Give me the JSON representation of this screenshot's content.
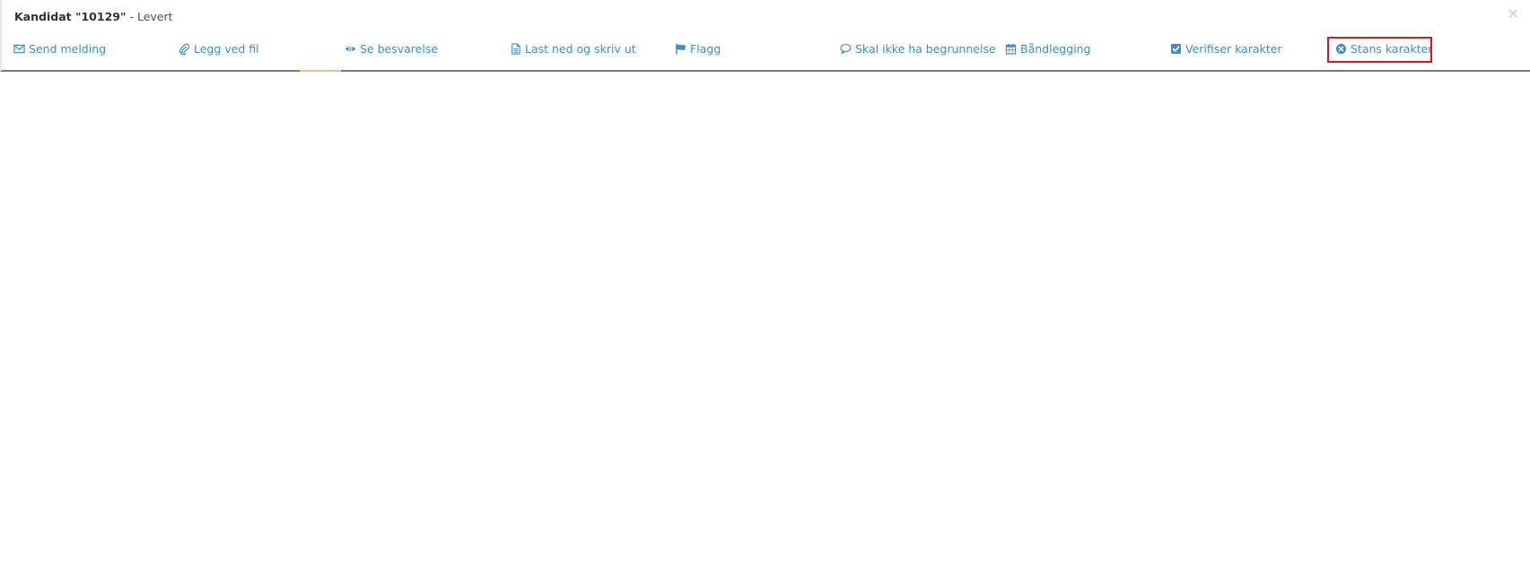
{
  "panel": {
    "title_name": "Kandidat \"10129\"",
    "title_separator": " - ",
    "title_status": "Levert",
    "close_glyph": "×"
  },
  "actions": [
    {
      "label": "Send melding",
      "icon": "envelope-icon"
    },
    {
      "label": "Legg ved fil",
      "icon": "paperclip-icon"
    },
    {
      "label": "Se besvarelse",
      "icon": "eye-icon"
    },
    {
      "label": "Last ned og skriv ut",
      "icon": "document-icon"
    },
    {
      "label": "Flagg",
      "icon": "flag-icon"
    },
    {
      "label": "Skal ikke ha begrunnelse",
      "icon": "comment-icon"
    },
    {
      "label": "Båndlegging",
      "icon": "calendar-icon"
    },
    {
      "label": "Verifiser karakter",
      "icon": "check-square-icon"
    },
    {
      "label": "Stans karakter",
      "icon": "times-circle-icon",
      "highlighted": true
    }
  ],
  "colors": {
    "link": "#3c8fc8",
    "highlight_border": "#e0141e",
    "title_text": "#333333"
  }
}
